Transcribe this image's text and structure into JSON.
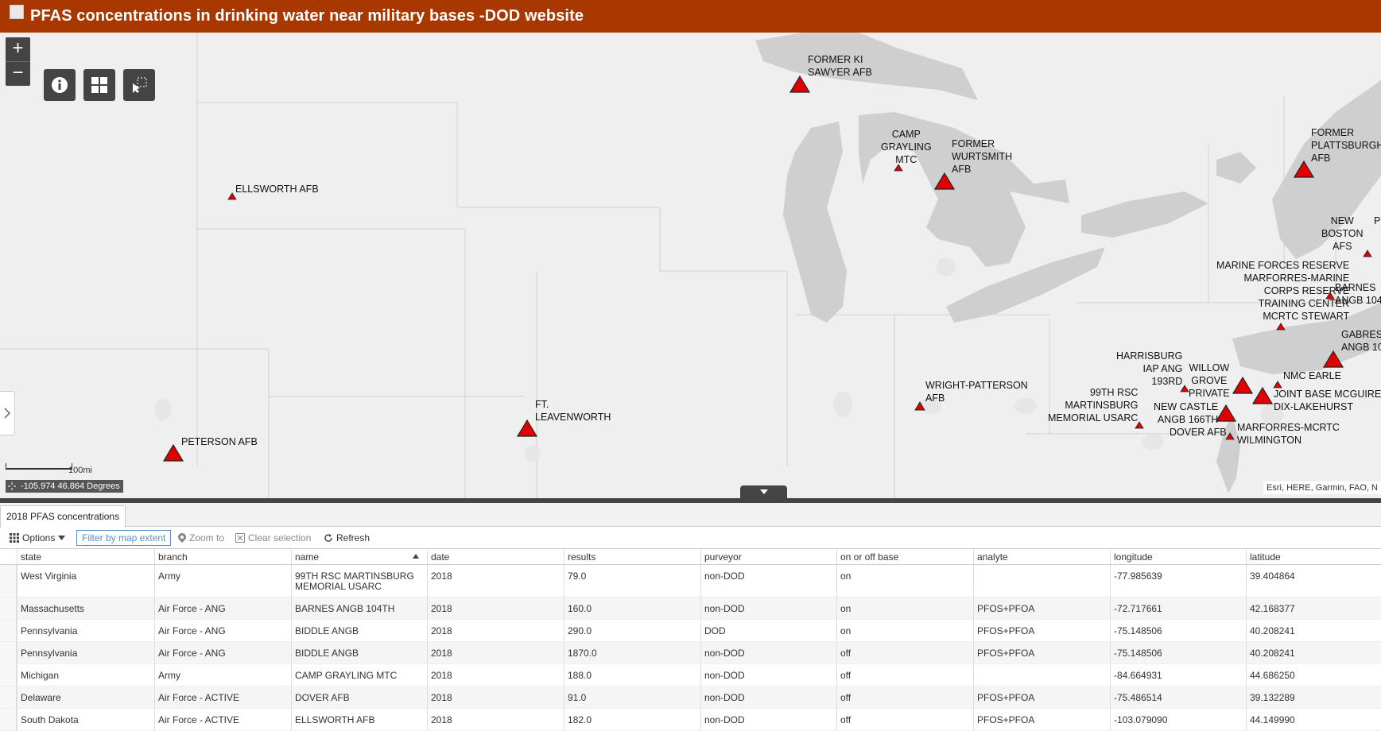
{
  "header": {
    "title": "PFAS concentrations in drinking water near military bases -DOD website"
  },
  "map": {
    "zoom_in": "+",
    "zoom_out": "−",
    "scale_label": "100mi",
    "coordinates": "-105.974 46.864 Degrees",
    "attribution": "Esri, HERE, Garmin, FAO, N",
    "sites": [
      {
        "label": "FORMER KI\nSAWYER AFB"
      },
      {
        "label": "CAMP\nGRAYLING\nMTC"
      },
      {
        "label": "FORMER\nWURTSMITH\nAFB"
      },
      {
        "label": "ELLSWORTH AFB"
      },
      {
        "label": "FORMER\nPLATTSBURGH\nAFB"
      },
      {
        "label": "NEW\nBOSTON\nAFS"
      },
      {
        "label": "MARINE FORCES RESERVE\nMARFORRES-MARINE\nCORPS RESERVE\nTRAINING CENTER\nMCRTC STEWART"
      },
      {
        "label": "BARNES\nANGB 104"
      },
      {
        "label": "GABRESI\nANGB 10"
      },
      {
        "label": "HARRISBURG\nIAP ANG\n193RD"
      },
      {
        "label": "WILLOW\nGROVE\nPRIVATE"
      },
      {
        "label": "NMC EARLE"
      },
      {
        "label": "JOINT BASE MCGUIRE-\nDIX-LAKEHURST"
      },
      {
        "label": "99TH RSC\nMARTINSBURG\nMEMORIAL USARC"
      },
      {
        "label": "NEW CASTLE\nANGB 166TH"
      },
      {
        "label": "DOVER AFB"
      },
      {
        "label": "MARFORRES-MCRTC\nWILMINGTON"
      },
      {
        "label": "WRIGHT-PATTERSON\nAFB"
      },
      {
        "label": "FT.\nLEAVENWORTH"
      },
      {
        "label": "PETERSON AFB"
      },
      {
        "label": "P"
      }
    ]
  },
  "table": {
    "tab_label": "2018 PFAS concentrations",
    "toolbar": {
      "options": "Options",
      "filter": "Filter by map extent",
      "zoom": "Zoom to",
      "clear": "Clear selection",
      "refresh": "Refresh"
    },
    "columns": [
      "state",
      "branch",
      "name",
      "date",
      "results",
      "purveyor",
      "on or off base",
      "analyte",
      "longitude",
      "latitude"
    ],
    "rows": [
      [
        "West Virginia",
        "Army",
        "99TH RSC MARTINSBURG\nMEMORIAL USARC",
        "2018",
        "79.0",
        "non-DOD",
        "on",
        "",
        "-77.985639",
        "39.404864"
      ],
      [
        "Massachusetts",
        "Air Force - ANG",
        "BARNES ANGB 104TH",
        "2018",
        "160.0",
        "non-DOD",
        "on",
        "PFOS+PFOA",
        "-72.717661",
        "42.168377"
      ],
      [
        "Pennsylvania",
        "Air Force - ANG",
        "BIDDLE ANGB",
        "2018",
        "290.0",
        "DOD",
        "on",
        "PFOS+PFOA",
        "-75.148506",
        "40.208241"
      ],
      [
        "Pennsylvania",
        "Air Force - ANG",
        "BIDDLE ANGB",
        "2018",
        "1870.0",
        "non-DOD",
        "off",
        "PFOS+PFOA",
        "-75.148506",
        "40.208241"
      ],
      [
        "Michigan",
        "Army",
        "CAMP GRAYLING MTC",
        "2018",
        "188.0",
        "non-DOD",
        "off",
        "",
        "-84.664931",
        "44.686250"
      ],
      [
        "Delaware",
        "Air Force - ACTIVE",
        "DOVER AFB",
        "2018",
        "91.0",
        "non-DOD",
        "off",
        "PFOS+PFOA",
        "-75.486514",
        "39.132289"
      ],
      [
        "South Dakota",
        "Air Force - ACTIVE",
        "ELLSWORTH AFB",
        "2018",
        "182.0",
        "non-DOD",
        "off",
        "PFOS+PFOA",
        "-103.079090",
        "44.149990"
      ]
    ]
  },
  "colors": {
    "header": "#a83800",
    "marker": "#e00000",
    "water": "#cfcfcf",
    "land": "#efefef"
  }
}
